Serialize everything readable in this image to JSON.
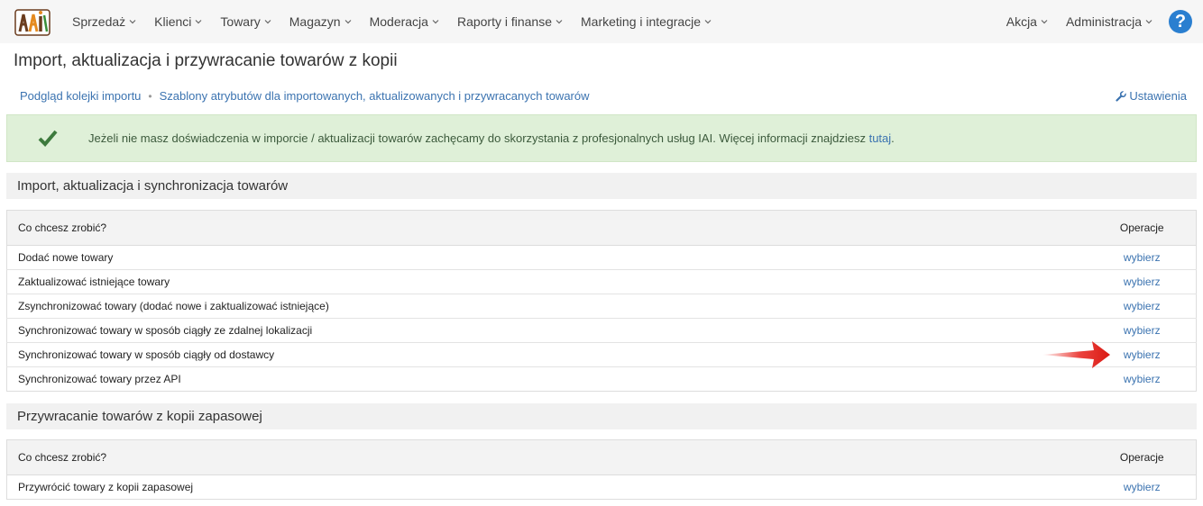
{
  "nav": {
    "left": [
      {
        "label": "Sprzedaż"
      },
      {
        "label": "Klienci"
      },
      {
        "label": "Towary"
      },
      {
        "label": "Magazyn"
      },
      {
        "label": "Moderacja"
      },
      {
        "label": "Raporty i finanse"
      },
      {
        "label": "Marketing i integracje"
      }
    ],
    "right": [
      {
        "label": "Akcja"
      },
      {
        "label": "Administracja"
      }
    ],
    "help_symbol": "?"
  },
  "page": {
    "title": "Import, aktualizacja i przywracanie towarów z kopii"
  },
  "subnav": {
    "link1": "Podgląd kolejki importu",
    "separator": "•",
    "link2": "Szablony atrybutów dla importowanych, aktualizowanych i przywracanych towarów",
    "settings": "Ustawienia"
  },
  "alert": {
    "text": "Jeżeli nie masz doświadczenia w imporcie / aktualizacji towarów zachęcamy do skorzystania z profesjonalnych usług IAI. Więcej informacji znajdziesz ",
    "link": "tutaj",
    "after": ".",
    "color": "#dff0d8"
  },
  "section1": {
    "title": "Import, aktualizacja i synchronizacja towarów",
    "col_question": "Co chcesz zrobić?",
    "col_ops": "Operacje",
    "rows": [
      {
        "label": "Dodać nowe towary",
        "action": "wybierz"
      },
      {
        "label": "Zaktualizować istniejące towary",
        "action": "wybierz"
      },
      {
        "label": "Zsynchronizować towary (dodać nowe i zaktualizować istniejące)",
        "action": "wybierz"
      },
      {
        "label": "Synchronizować towary w sposób ciągły ze zdalnej lokalizacji",
        "action": "wybierz"
      },
      {
        "label": "Synchronizować towary w sposób ciągły od dostawcy",
        "action": "wybierz"
      },
      {
        "label": "Synchronizować towary przez API",
        "action": "wybierz"
      }
    ]
  },
  "section2": {
    "title": "Przywracanie towarów z kopii zapasowej",
    "col_question": "Co chcesz zrobić?",
    "col_ops": "Operacje",
    "rows": [
      {
        "label": "Przywrócić towary z kopii zapasowej",
        "action": "wybierz"
      }
    ]
  },
  "colors": {
    "link": "#3b73b0",
    "help": "#2a7fd0",
    "arrow": "#e8221c"
  }
}
